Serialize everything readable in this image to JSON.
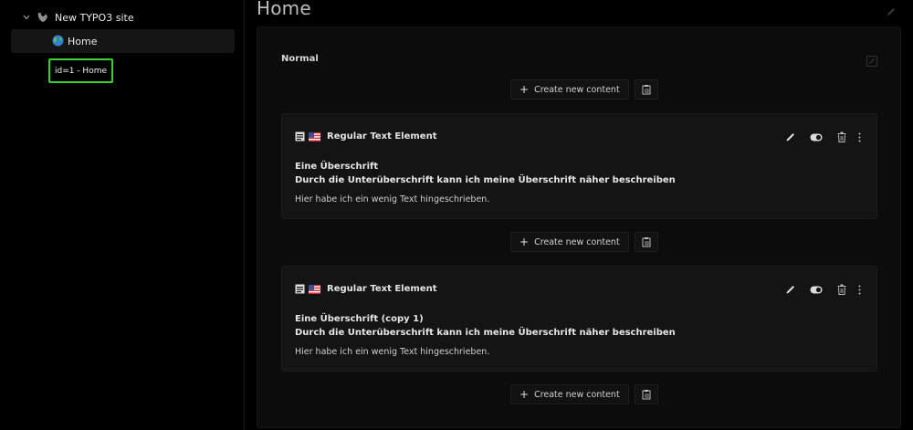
{
  "tree": {
    "root_label": "New TYPO3 site",
    "home_label": "Home",
    "tooltip": "id=1 - Home"
  },
  "page": {
    "title": "Home",
    "column_title": "Normal"
  },
  "new_content_label": "Create new content",
  "elements": [
    {
      "type_label": "Regular Text Element",
      "header": "Eine Überschrift",
      "subheader": "Durch die Unterüberschrift kann ich meine Überschrift näher beschreiben",
      "bodytext": "Hier habe ich ein wenig Text hingeschrieben."
    },
    {
      "type_label": "Regular Text Element",
      "header": "Eine Überschrift (copy 1)",
      "subheader": "Durch die Unterüberschrift kann ich meine Überschrift näher beschreiben",
      "bodytext": "Hier habe ich ein wenig Text hingeschrieben."
    }
  ],
  "icons": {
    "tree_chevron": "chevron-down-icon",
    "site_logo": "typo3-logo-icon",
    "page_globe": "globe-icon",
    "content_type": "text-element-icon",
    "language": "us-flag-icon",
    "edit": "pencil-icon",
    "toggle": "toggle-icon",
    "delete": "trash-icon",
    "more": "more-vertical-icon",
    "paste": "clipboard-paste-icon"
  },
  "colors": {
    "background": "#000000",
    "panel": "#0c0c0c",
    "card": "#141414",
    "highlight_border": "#3bd12c"
  }
}
